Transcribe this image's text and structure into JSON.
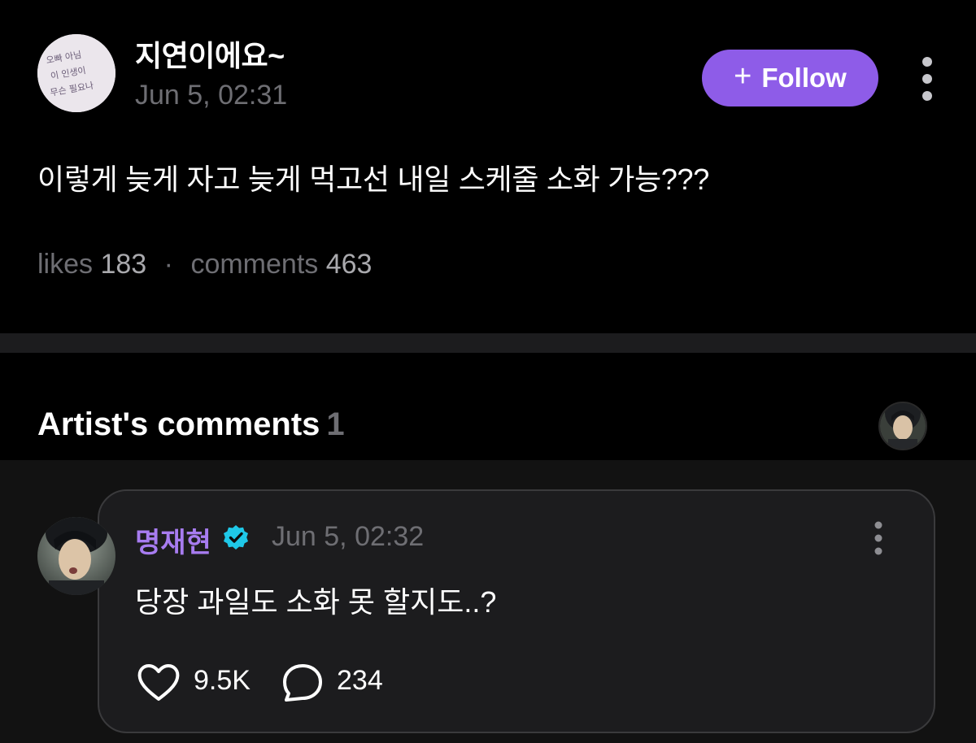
{
  "post": {
    "author": "지연이에요~",
    "time": "Jun 5, 02:31",
    "avatar_text": [
      "오빠 아님",
      "이 인생이",
      "무슨 필요나"
    ],
    "follow_label": "Follow",
    "body": "이렇게 늦게 자고 늦게 먹고선 내일 스케줄 소화 가능???",
    "likes_label": "likes",
    "likes_count": "183",
    "separator": "·",
    "comments_label": "comments",
    "comments_count": "463"
  },
  "artist_comments": {
    "title": "Artist's comments",
    "count": "1"
  },
  "comment": {
    "author": "명재현",
    "verified": true,
    "time": "Jun 5, 02:32",
    "text": "당장 과일도 소화 못 할지도..?",
    "like_count": "9.5K",
    "reply_count": "234"
  },
  "colors": {
    "background": "#000000",
    "follow_button": "#8e5ce8",
    "artist_name": "#a77cf0",
    "verified_badge": "#1fc8e8",
    "muted_text": "#6e6e73"
  },
  "icons": {
    "follow": "plus-icon",
    "post_menu": "more-vertical-icon",
    "comment_menu": "more-vertical-icon",
    "verified": "verified-badge-icon",
    "like": "heart-icon",
    "reply": "comment-bubble-icon"
  }
}
